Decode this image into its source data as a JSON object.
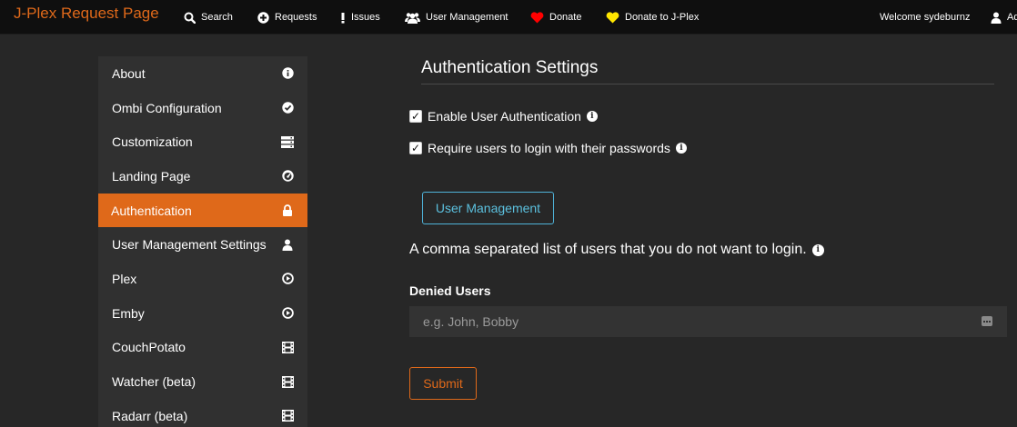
{
  "navbar": {
    "brand": "J-Plex Request Page",
    "items": [
      {
        "label": "Search",
        "icon": "search-icon"
      },
      {
        "label": "Requests",
        "icon": "plus-circle-icon"
      },
      {
        "label": "Issues",
        "icon": "exclamation-icon"
      },
      {
        "label": "User Management",
        "icon": "users-icon"
      },
      {
        "label": "Donate",
        "icon": "heart-icon",
        "icon_color": "#ff0000"
      },
      {
        "label": "Donate to J-Plex",
        "icon": "heart-icon",
        "icon_color": "#ffe600"
      }
    ],
    "welcome": "Welcome sydeburnz",
    "admin_truncated": "Ad"
  },
  "sidebar": {
    "items": [
      {
        "label": "About",
        "icon": "info-circle-icon"
      },
      {
        "label": "Ombi Configuration",
        "icon": "check-circle-icon"
      },
      {
        "label": "Customization",
        "icon": "server-icon"
      },
      {
        "label": "Landing Page",
        "icon": "dashboard-icon"
      },
      {
        "label": "Authentication",
        "icon": "lock-icon",
        "active": true
      },
      {
        "label": "User Management Settings",
        "icon": "user-icon"
      },
      {
        "label": "Plex",
        "icon": "play-circle-icon"
      },
      {
        "label": "Emby",
        "icon": "play-circle-icon"
      },
      {
        "label": "CouchPotato",
        "icon": "film-icon"
      },
      {
        "label": "Watcher (beta)",
        "icon": "film-icon"
      },
      {
        "label": "Radarr (beta)",
        "icon": "film-icon"
      }
    ]
  },
  "main": {
    "title": "Authentication Settings",
    "checkboxes": [
      {
        "label": "Enable User Authentication",
        "checked": true
      },
      {
        "label": "Require users to login with their passwords",
        "checked": true
      }
    ],
    "user_management_button": "User Management",
    "description": "A comma separated list of users that you do not want to login.",
    "denied_users_label": "Denied Users",
    "denied_users_placeholder": "e.g. John, Bobby",
    "denied_users_value": "",
    "submit_button": "Submit"
  },
  "colors": {
    "accent": "#df691a",
    "info": "#5bc0de",
    "background": "#272727",
    "sidebar": "#303030",
    "navbar": "#0f0f0f"
  }
}
